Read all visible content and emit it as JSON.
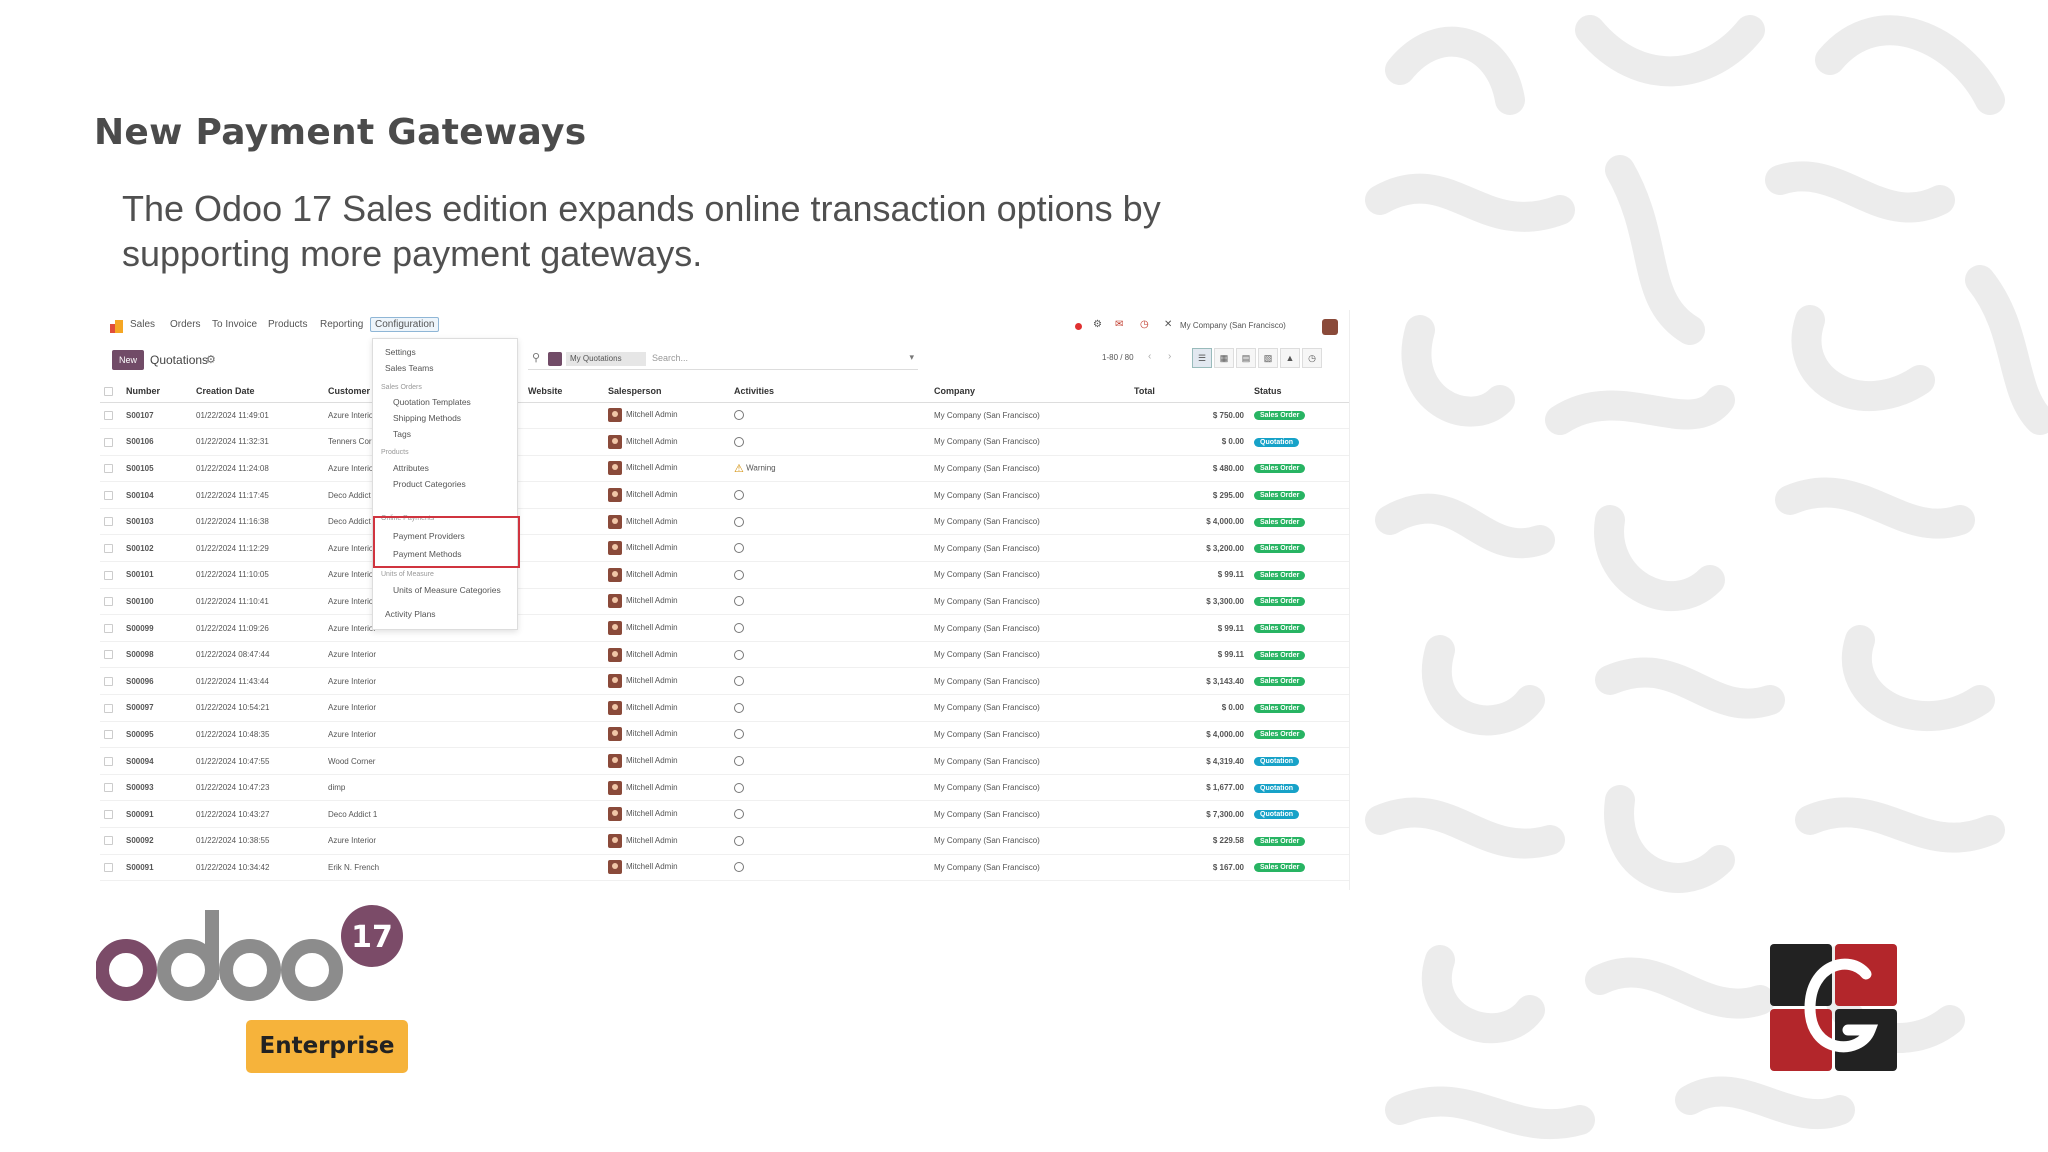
{
  "slide": {
    "title": "New Payment Gateways",
    "description": "The Odoo 17 Sales edition expands online transaction options by supporting more payment gateways."
  },
  "app": {
    "nav": [
      "Sales",
      "Orders",
      "To Invoice",
      "Products",
      "Reporting",
      "Configuration"
    ],
    "company": "My Company (San Francisco)",
    "new_label": "New",
    "breadcrumb": "Quotations",
    "search_facet": "My Quotations",
    "search_placeholder": "Search...",
    "pager": "1-80 / 80",
    "columns": [
      "Number",
      "Creation Date",
      "Customer",
      "Website",
      "Salesperson",
      "Activities",
      "Company",
      "Total",
      "Status"
    ],
    "rows": [
      {
        "number": "S00107",
        "date": "01/22/2024 11:49:01",
        "customer": "Azure Interior",
        "salesperson": "Mitchell Admin",
        "activity": "",
        "company": "My Company (San Francisco)",
        "total": "$ 750.00",
        "status": "Sales Order"
      },
      {
        "number": "S00106",
        "date": "01/22/2024 11:32:31",
        "customer": "Tenners Corp",
        "salesperson": "Mitchell Admin",
        "activity": "",
        "company": "My Company (San Francisco)",
        "total": "$ 0.00",
        "status": "Quotation"
      },
      {
        "number": "S00105",
        "date": "01/22/2024 11:24:08",
        "customer": "Azure Interior",
        "salesperson": "Mitchell Admin",
        "activity": "Warning",
        "company": "My Company (San Francisco)",
        "total": "$ 480.00",
        "status": "Sales Order"
      },
      {
        "number": "S00104",
        "date": "01/22/2024 11:17:45",
        "customer": "Deco Addict",
        "salesperson": "Mitchell Admin",
        "activity": "",
        "company": "My Company (San Francisco)",
        "total": "$ 295.00",
        "status": "Sales Order"
      },
      {
        "number": "S00103",
        "date": "01/22/2024 11:16:38",
        "customer": "Deco Addict",
        "salesperson": "Mitchell Admin",
        "activity": "",
        "company": "My Company (San Francisco)",
        "total": "$ 4,000.00",
        "status": "Sales Order"
      },
      {
        "number": "S00102",
        "date": "01/22/2024 11:12:29",
        "customer": "Azure Interior",
        "salesperson": "Mitchell Admin",
        "activity": "",
        "company": "My Company (San Francisco)",
        "total": "$ 3,200.00",
        "status": "Sales Order"
      },
      {
        "number": "S00101",
        "date": "01/22/2024 11:10:05",
        "customer": "Azure Interior",
        "salesperson": "Mitchell Admin",
        "activity": "",
        "company": "My Company (San Francisco)",
        "total": "$ 99.11",
        "status": "Sales Order"
      },
      {
        "number": "S00100",
        "date": "01/22/2024 11:10:41",
        "customer": "Azure Interior",
        "salesperson": "Mitchell Admin",
        "activity": "",
        "company": "My Company (San Francisco)",
        "total": "$ 3,300.00",
        "status": "Sales Order"
      },
      {
        "number": "S00099",
        "date": "01/22/2024 11:09:26",
        "customer": "Azure Interior",
        "salesperson": "Mitchell Admin",
        "activity": "",
        "company": "My Company (San Francisco)",
        "total": "$ 99.11",
        "status": "Sales Order"
      },
      {
        "number": "S00098",
        "date": "01/22/2024 08:47:44",
        "customer": "Azure Interior",
        "salesperson": "Mitchell Admin",
        "activity": "",
        "company": "My Company (San Francisco)",
        "total": "$ 99.11",
        "status": "Sales Order"
      },
      {
        "number": "S00096",
        "date": "01/22/2024 11:43:44",
        "customer": "Azure Interior",
        "salesperson": "Mitchell Admin",
        "activity": "",
        "company": "My Company (San Francisco)",
        "total": "$ 3,143.40",
        "status": "Sales Order"
      },
      {
        "number": "S00097",
        "date": "01/22/2024 10:54:21",
        "customer": "Azure Interior",
        "salesperson": "Mitchell Admin",
        "activity": "",
        "company": "My Company (San Francisco)",
        "total": "$ 0.00",
        "status": "Sales Order"
      },
      {
        "number": "S00095",
        "date": "01/22/2024 10:48:35",
        "customer": "Azure Interior",
        "salesperson": "Mitchell Admin",
        "activity": "",
        "company": "My Company (San Francisco)",
        "total": "$ 4,000.00",
        "status": "Sales Order"
      },
      {
        "number": "S00094",
        "date": "01/22/2024 10:47:55",
        "customer": "Wood Corner",
        "salesperson": "Mitchell Admin",
        "activity": "",
        "company": "My Company (San Francisco)",
        "total": "$ 4,319.40",
        "status": "Quotation"
      },
      {
        "number": "S00093",
        "date": "01/22/2024 10:47:23",
        "customer": "dimp",
        "salesperson": "Mitchell Admin",
        "activity": "",
        "company": "My Company (San Francisco)",
        "total": "$ 1,677.00",
        "status": "Quotation"
      },
      {
        "number": "S00091",
        "date": "01/22/2024 10:43:27",
        "customer": "Deco Addict 1",
        "salesperson": "Mitchell Admin",
        "activity": "",
        "company": "My Company (San Francisco)",
        "total": "$ 7,300.00",
        "status": "Quotation"
      },
      {
        "number": "S00092",
        "date": "01/22/2024 10:38:55",
        "customer": "Azure Interior",
        "salesperson": "Mitchell Admin",
        "activity": "",
        "company": "My Company (San Francisco)",
        "total": "$ 229.58",
        "status": "Sales Order"
      },
      {
        "number": "S00091",
        "date": "01/22/2024 10:34:42",
        "customer": "Erik N. French",
        "salesperson": "Mitchell Admin",
        "activity": "",
        "company": "My Company (San Francisco)",
        "total": "$ 167.00",
        "status": "Sales Order"
      }
    ],
    "config_menu": {
      "settings": "Settings",
      "sales_teams": "Sales Teams",
      "sec_sales_orders": "Sales Orders",
      "quotation_templates": "Quotation Templates",
      "shipping_methods": "Shipping Methods",
      "tags": "Tags",
      "sec_products": "Products",
      "attributes": "Attributes",
      "product_categories": "Product Categories",
      "sec_online_payments": "Online Payments",
      "payment_providers": "Payment Providers",
      "payment_methods": "Payment Methods",
      "sec_units": "Units of Measure",
      "uom_categories": "Units of Measure Categories",
      "activity_plans": "Activity Plans"
    }
  },
  "logos": {
    "odoo_text": "odoo",
    "version": "17",
    "edition": "Enterprise"
  },
  "colors": {
    "odoo_purple": "#714b67",
    "sales_order_badge": "#28b463",
    "quotation_badge": "#17a2c8",
    "enterprise_badge": "#f6b33b",
    "highlight_red": "#d0343f"
  }
}
